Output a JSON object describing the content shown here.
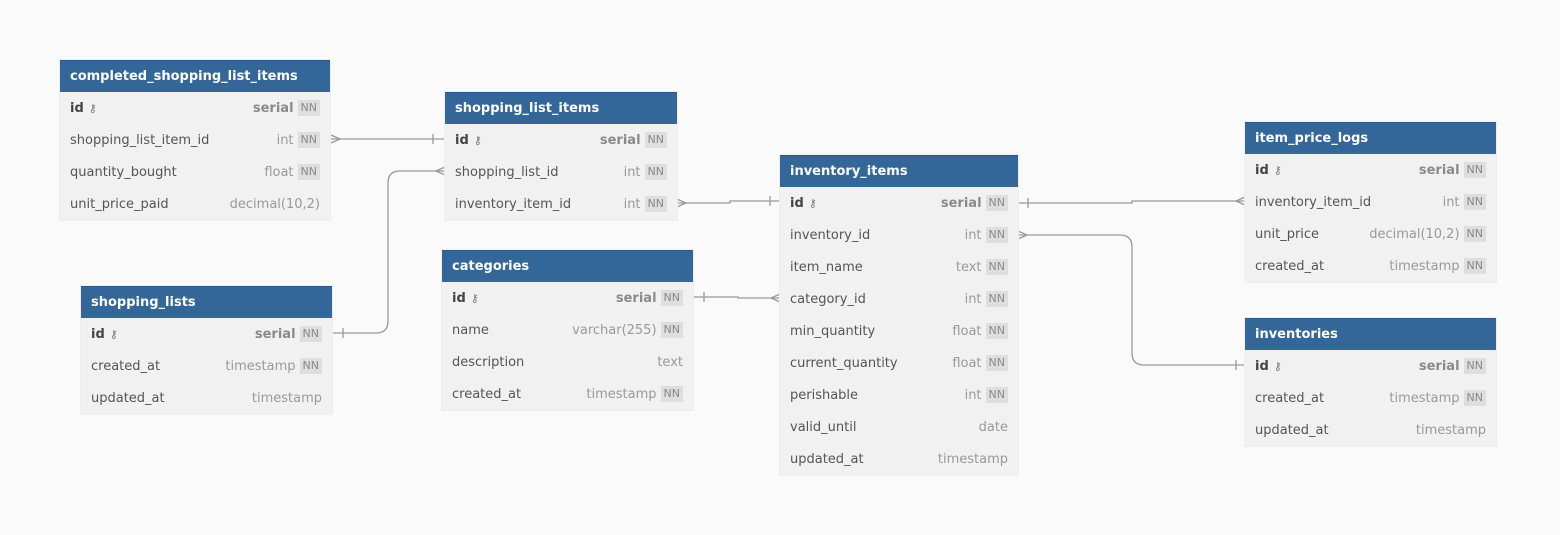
{
  "diagram": {
    "key_icon": "key-icon",
    "colors": {
      "header": "#336699",
      "header_text": "#ffffff",
      "body": "#f1f1f1",
      "connector": "#999999",
      "background": "#fafafa"
    },
    "tables": [
      {
        "name": "completed_shopping_list_items",
        "fields": [
          {
            "name": "id",
            "type": "serial",
            "nn": "NN",
            "pk": true
          },
          {
            "name": "shopping_list_item_id",
            "type": "int",
            "nn": "NN"
          },
          {
            "name": "quantity_bought",
            "type": "float",
            "nn": "NN"
          },
          {
            "name": "unit_price_paid",
            "type": "decimal(10,2)",
            "nn": ""
          }
        ]
      },
      {
        "name": "shopping_list_items",
        "fields": [
          {
            "name": "id",
            "type": "serial",
            "nn": "NN",
            "pk": true
          },
          {
            "name": "shopping_list_id",
            "type": "int",
            "nn": "NN"
          },
          {
            "name": "inventory_item_id",
            "type": "int",
            "nn": "NN"
          }
        ]
      },
      {
        "name": "shopping_lists",
        "fields": [
          {
            "name": "id",
            "type": "serial",
            "nn": "NN",
            "pk": true
          },
          {
            "name": "created_at",
            "type": "timestamp",
            "nn": "NN"
          },
          {
            "name": "updated_at",
            "type": "timestamp",
            "nn": ""
          }
        ]
      },
      {
        "name": "categories",
        "fields": [
          {
            "name": "id",
            "type": "serial",
            "nn": "NN",
            "pk": true
          },
          {
            "name": "name",
            "type": "varchar(255)",
            "nn": "NN"
          },
          {
            "name": "description",
            "type": "text",
            "nn": ""
          },
          {
            "name": "created_at",
            "type": "timestamp",
            "nn": "NN"
          }
        ]
      },
      {
        "name": "inventory_items",
        "fields": [
          {
            "name": "id",
            "type": "serial",
            "nn": "NN",
            "pk": true
          },
          {
            "name": "inventory_id",
            "type": "int",
            "nn": "NN"
          },
          {
            "name": "item_name",
            "type": "text",
            "nn": "NN"
          },
          {
            "name": "category_id",
            "type": "int",
            "nn": "NN"
          },
          {
            "name": "min_quantity",
            "type": "float",
            "nn": "NN"
          },
          {
            "name": "current_quantity",
            "type": "float",
            "nn": "NN"
          },
          {
            "name": "perishable",
            "type": "int",
            "nn": "NN"
          },
          {
            "name": "valid_until",
            "type": "date",
            "nn": ""
          },
          {
            "name": "updated_at",
            "type": "timestamp",
            "nn": ""
          }
        ]
      },
      {
        "name": "item_price_logs",
        "fields": [
          {
            "name": "id",
            "type": "serial",
            "nn": "NN",
            "pk": true
          },
          {
            "name": "inventory_item_id",
            "type": "int",
            "nn": "NN"
          },
          {
            "name": "unit_price",
            "type": "decimal(10,2)",
            "nn": "NN"
          },
          {
            "name": "created_at",
            "type": "timestamp",
            "nn": "NN"
          }
        ]
      },
      {
        "name": "inventories",
        "fields": [
          {
            "name": "id",
            "type": "serial",
            "nn": "NN",
            "pk": true
          },
          {
            "name": "created_at",
            "type": "timestamp",
            "nn": "NN"
          },
          {
            "name": "updated_at",
            "type": "timestamp",
            "nn": ""
          }
        ]
      }
    ],
    "relationships": [
      {
        "from": "completed_shopping_list_items.shopping_list_item_id",
        "to": "shopping_list_items.id",
        "cardinality": "many-to-one"
      },
      {
        "from": "shopping_list_items.shopping_list_id",
        "to": "shopping_lists.id",
        "cardinality": "many-to-one"
      },
      {
        "from": "shopping_list_items.inventory_item_id",
        "to": "inventory_items.id",
        "cardinality": "many-to-one"
      },
      {
        "from": "inventory_items.category_id",
        "to": "categories.id",
        "cardinality": "many-to-one"
      },
      {
        "from": "item_price_logs.inventory_item_id",
        "to": "inventory_items.id",
        "cardinality": "many-to-one"
      },
      {
        "from": "inventory_items.inventory_id",
        "to": "inventories.id",
        "cardinality": "many-to-one"
      }
    ]
  }
}
